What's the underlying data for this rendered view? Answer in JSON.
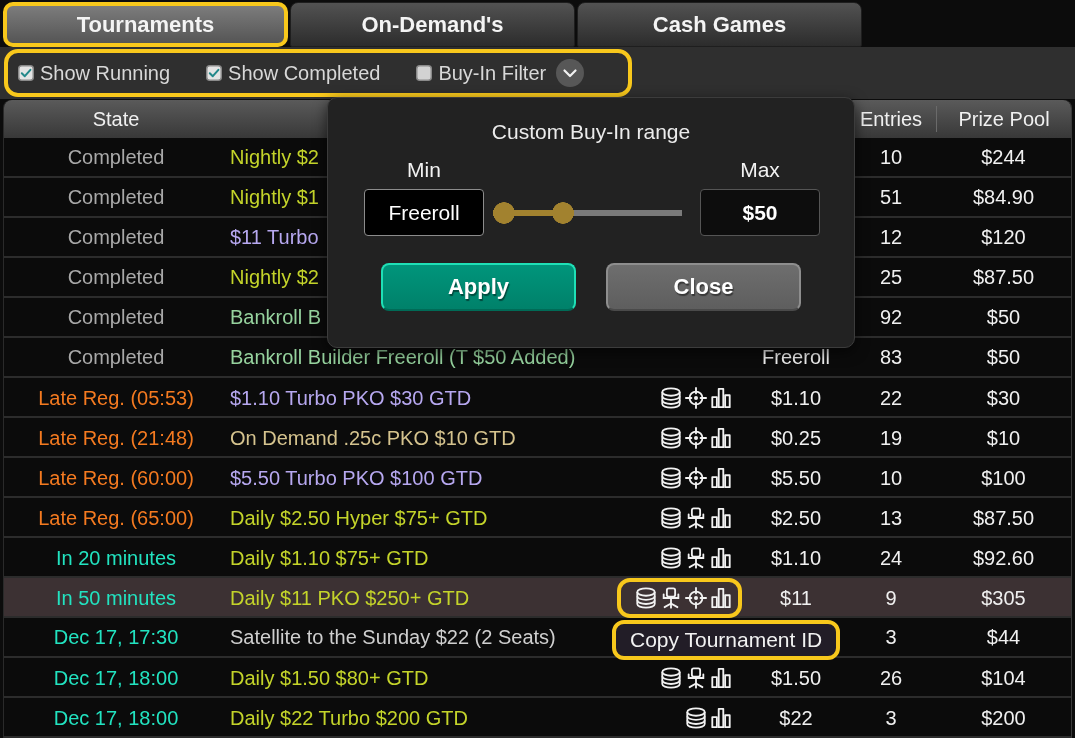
{
  "tabs": [
    {
      "label": "Tournaments",
      "selected": true,
      "highlighted": true
    },
    {
      "label": "On-Demand's",
      "selected": false,
      "highlighted": false
    },
    {
      "label": "Cash Games",
      "selected": false,
      "highlighted": false
    }
  ],
  "filters": {
    "highlighted": true,
    "options": [
      {
        "label": "Show Running",
        "checked": true
      },
      {
        "label": "Show Completed",
        "checked": true
      },
      {
        "label": "Buy-In Filter",
        "checked": false
      }
    ]
  },
  "table": {
    "header": {
      "state": "State",
      "entries": "Entries",
      "prize_pool": "Prize Pool"
    },
    "rows": [
      {
        "state": {
          "text": "Completed",
          "color": "#a9a9a9"
        },
        "column_2": {
          "text": "Nightly $2",
          "color": "#c4d42a"
        },
        "entries": "10",
        "prize_pool": "$244",
        "selected": false
      },
      {
        "state": {
          "text": "Completed",
          "color": "#a9a9a9"
        },
        "column_2": {
          "text": "Nightly $1",
          "color": "#c4d42a"
        },
        "entries": "51",
        "prize_pool": "$84.90",
        "selected": false
      },
      {
        "state": {
          "text": "Completed",
          "color": "#a9a9a9"
        },
        "column_2": {
          "text": "$11 Turbo",
          "color": "#b7a8f0"
        },
        "entries": "12",
        "prize_pool": "$120",
        "selected": false
      },
      {
        "state": {
          "text": "Completed",
          "color": "#a9a9a9"
        },
        "column_2": {
          "text": "Nightly $2",
          "color": "#c4d42a"
        },
        "entries": "25",
        "prize_pool": "$87.50",
        "selected": false
      },
      {
        "state": {
          "text": "Completed",
          "color": "#a9a9a9"
        },
        "column_2": {
          "text": "Bankroll B",
          "color": "#96d39e"
        },
        "entries": "92",
        "prize_pool": "$50",
        "selected": false
      },
      {
        "state": {
          "text": "Completed",
          "color": "#a9a9a9"
        },
        "column_2": {
          "text": "Bankroll Builder Freeroll (T $50 Added)",
          "color": "#96d39e"
        },
        "column_4": "Freeroll",
        "entries": "83",
        "prize_pool": "$50",
        "selected": false
      },
      {
        "state": {
          "text": "Late Reg. (05:53)",
          "color": "#f47a20"
        },
        "column_2": {
          "text": "$1.10 Turbo PKO $30 GTD",
          "color": "#b7a8f0"
        },
        "icons": {
          "highlighted": false,
          "items": [
            {
              "kind": "coins"
            },
            {
              "kind": "target"
            },
            {
              "kind": "chart"
            }
          ]
        },
        "column_4": "$1.10",
        "entries": "22",
        "prize_pool": "$30",
        "selected": false
      },
      {
        "state": {
          "text": "Late Reg. (21:48)",
          "color": "#f47a20"
        },
        "column_2": {
          "text": "On Demand .25c PKO $10 GTD",
          "color": "#d5c38e"
        },
        "icons": {
          "highlighted": false,
          "items": [
            {
              "kind": "coins"
            },
            {
              "kind": "target"
            },
            {
              "kind": "chart"
            }
          ]
        },
        "column_4": "$0.25",
        "entries": "19",
        "prize_pool": "$10",
        "selected": false
      },
      {
        "state": {
          "text": "Late Reg. (60:00)",
          "color": "#f47a20"
        },
        "column_2": {
          "text": "$5.50 Turbo PKO $100 GTD",
          "color": "#b7a8f0"
        },
        "icons": {
          "highlighted": false,
          "items": [
            {
              "kind": "coins"
            },
            {
              "kind": "target"
            },
            {
              "kind": "chart"
            }
          ]
        },
        "column_4": "$5.50",
        "entries": "10",
        "prize_pool": "$100",
        "selected": false
      },
      {
        "state": {
          "text": "Late Reg. (65:00)",
          "color": "#f47a20"
        },
        "column_2": {
          "text": "Daily $2.50 Hyper $75+ GTD",
          "color": "#c4d42a"
        },
        "icons": {
          "highlighted": false,
          "items": [
            {
              "kind": "coins"
            },
            {
              "kind": "chair"
            },
            {
              "kind": "chart"
            }
          ]
        },
        "column_4": "$2.50",
        "entries": "13",
        "prize_pool": "$87.50",
        "selected": false
      },
      {
        "state": {
          "text": "In 20 minutes",
          "color": "#22e3c0"
        },
        "column_2": {
          "text": "Daily $1.10 $75+ GTD",
          "color": "#c4d42a"
        },
        "icons": {
          "highlighted": false,
          "items": [
            {
              "kind": "coins"
            },
            {
              "kind": "chair"
            },
            {
              "kind": "chart"
            }
          ]
        },
        "column_4": "$1.10",
        "entries": "24",
        "prize_pool": "$92.60",
        "selected": false
      },
      {
        "state": {
          "text": "In 50 minutes",
          "color": "#22e3c0"
        },
        "column_2": {
          "text": "Daily $11 PKO $250+ GTD",
          "color": "#c4d42a"
        },
        "icons": {
          "highlighted": true,
          "items": [
            {
              "kind": "coins"
            },
            {
              "kind": "chair"
            },
            {
              "kind": "target"
            },
            {
              "kind": "chart"
            }
          ]
        },
        "column_4": "$11",
        "entries": "9",
        "prize_pool": "$305",
        "selected": true
      },
      {
        "state": {
          "text": "Dec 17, 17:30",
          "color": "#22e3c0"
        },
        "column_2": {
          "text": "Satellite to the Sunday $22 (2 Seats)",
          "color": "#cfcfcf"
        },
        "entries": "3",
        "prize_pool": "$44",
        "selected": false
      },
      {
        "state": {
          "text": "Dec 17, 18:00",
          "color": "#22e3c0"
        },
        "column_2": {
          "text": "Daily $1.50 $80+ GTD",
          "color": "#c4d42a"
        },
        "icons": {
          "highlighted": false,
          "items": [
            {
              "kind": "coins"
            },
            {
              "kind": "chair"
            },
            {
              "kind": "chart"
            }
          ]
        },
        "column_4": "$1.50",
        "entries": "26",
        "prize_pool": "$104",
        "selected": false
      },
      {
        "state": {
          "text": "Dec 17, 18:00",
          "color": "#22e3c0"
        },
        "column_2": {
          "text": "Daily $22 Turbo $200 GTD",
          "color": "#c4d42a"
        },
        "icons": {
          "highlighted": false,
          "items": [
            {
              "kind": "coins"
            },
            {
              "kind": "chart"
            }
          ]
        },
        "column_4": "$22",
        "entries": "3",
        "prize_pool": "$200",
        "selected": false
      }
    ]
  },
  "buyin_popup": {
    "title": "Custom Buy-In range",
    "min_label": "Min",
    "min_value": "Freeroll",
    "max_label": "Max",
    "max_value": "$50",
    "slider": {
      "level": 0.43
    },
    "buttons": [
      {
        "label": "Apply",
        "kind": "primary"
      },
      {
        "label": "Close",
        "kind": "secondary"
      }
    ]
  },
  "tooltip": {
    "text": "Copy Tournament ID",
    "highlighted": true
  }
}
